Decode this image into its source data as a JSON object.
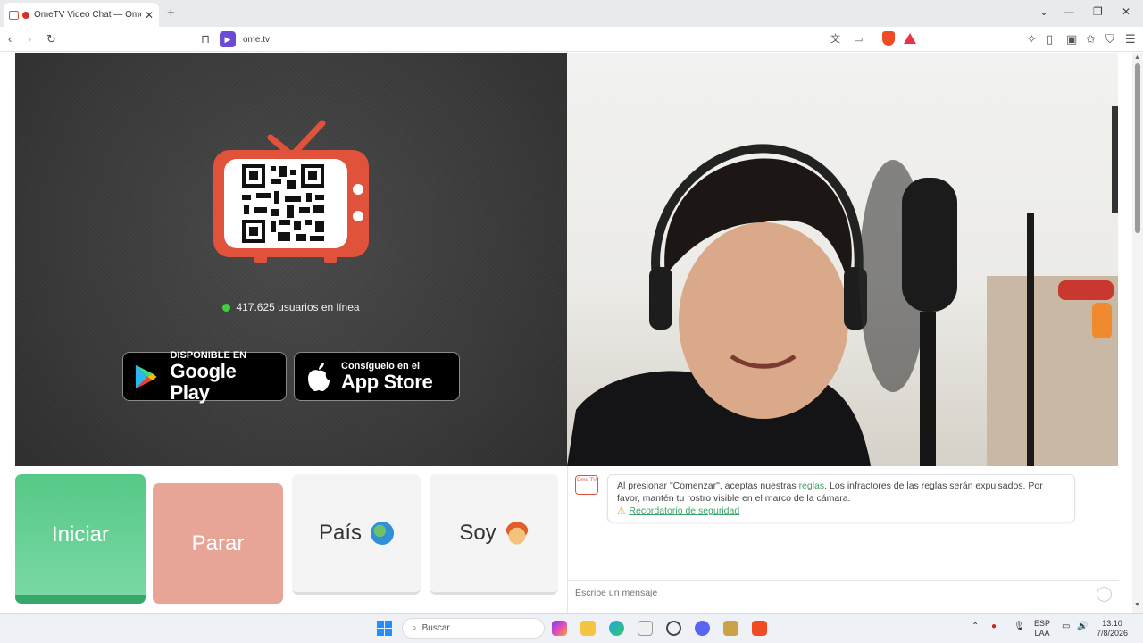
{
  "browser": {
    "tab_title": "OmeTV Video Chat — Omegl",
    "url": "ome.tv"
  },
  "left_panel": {
    "users_online": "417.625 usuarios en línea",
    "google_play": {
      "small": "DISPONIBLE EN",
      "big": "Google Play"
    },
    "app_store": {
      "small": "Consíguelo en el",
      "big": "App Store"
    }
  },
  "controls": {
    "start_label": "Iniciar",
    "stop_label": "Parar",
    "country_label": "País",
    "gender_label": "Soy"
  },
  "chat": {
    "avatar_text": "Ome TV",
    "rules_prefix": "Al presionar \"Comenzar\", aceptas nuestras ",
    "rules_link": "reglas",
    "rules_suffix": ". Los infractores de las reglas serán expulsados. Por favor, mantén tu rostro visible en el marco de la cámara.",
    "safety_link": "Recordatorio de seguridad",
    "input_placeholder": "Escribe un mensaje"
  },
  "taskbar": {
    "search_placeholder": "Buscar",
    "lang_top": "ESP",
    "lang_bottom": "LAA",
    "time": "13:10",
    "date": "7/8/2026"
  },
  "colors": {
    "start": "#55c987",
    "stop": "#e8a497",
    "accent_green": "#3ea36b",
    "tv_orange": "#e0533a"
  }
}
